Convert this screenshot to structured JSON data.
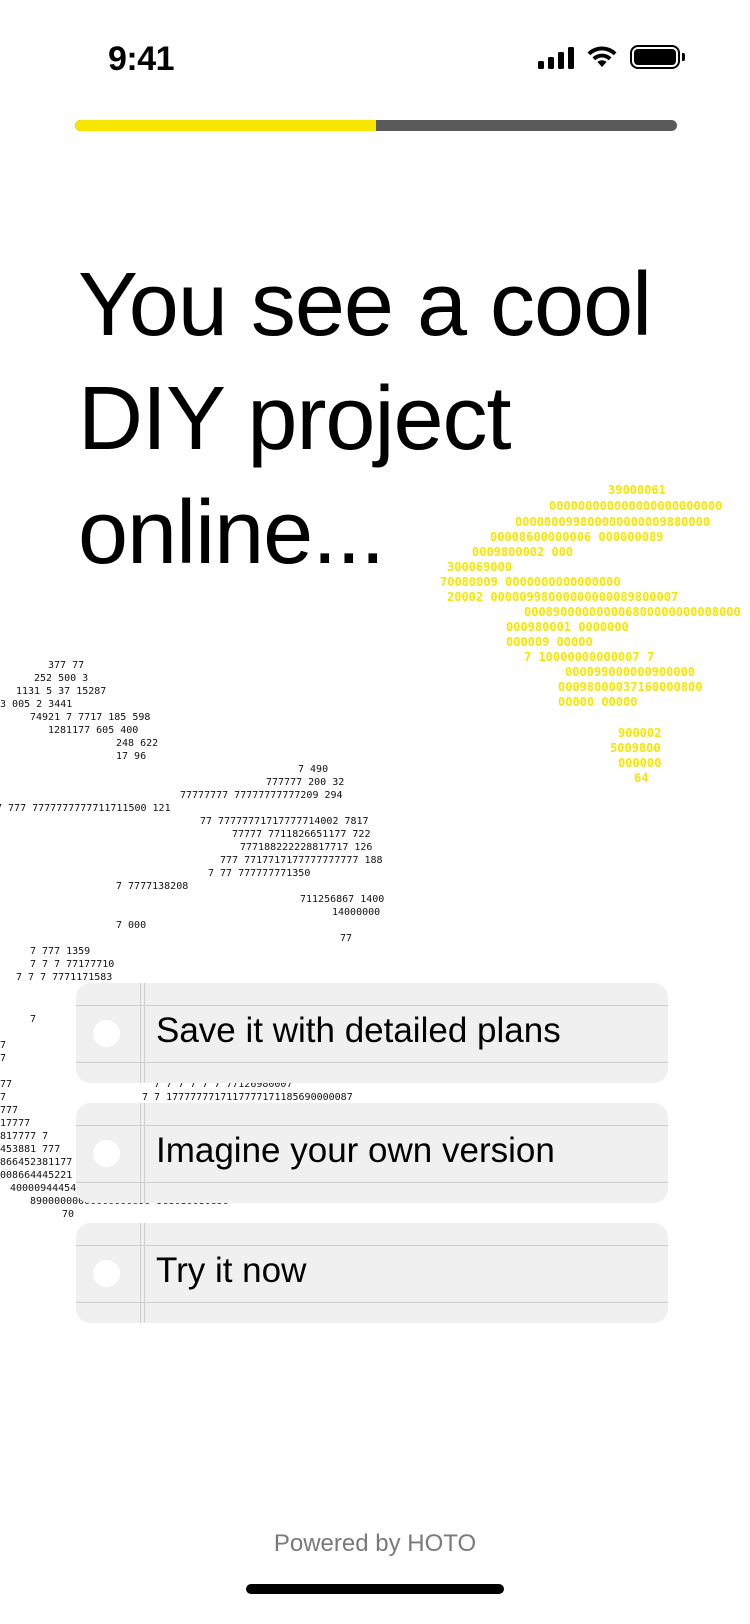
{
  "status_bar": {
    "time": "9:41",
    "icons": [
      "cellular-signal-icon",
      "wifi-icon",
      "battery-icon"
    ]
  },
  "progress": {
    "value": 0.5,
    "fill_color": "#f6e600",
    "track_color": "#5a5a5a"
  },
  "question": {
    "headline": "You see a cool DIY project online..."
  },
  "options": [
    {
      "label": "Save it with detailed plans",
      "selected": false
    },
    {
      "label": "Imagine your own version",
      "selected": false
    },
    {
      "label": "Try it now",
      "selected": false
    }
  ],
  "footer": {
    "powered_by": "Powered by HOTO"
  },
  "colors": {
    "accent_yellow": "#f6e600",
    "option_background": "#f0f0f0",
    "text_primary": "#000000",
    "text_muted": "#7a7a7a"
  }
}
